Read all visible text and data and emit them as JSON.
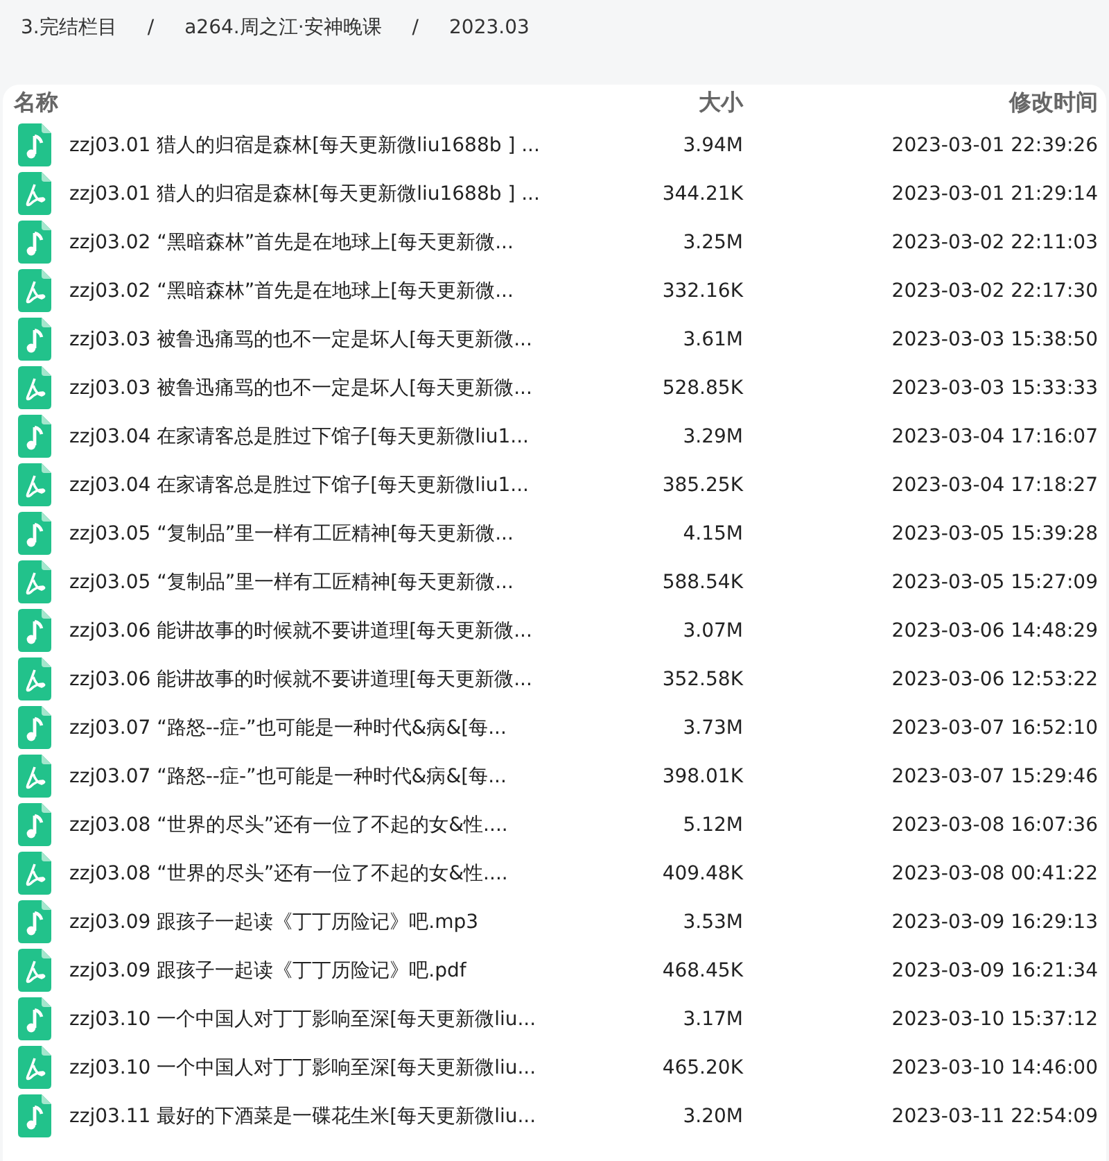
{
  "breadcrumb": [
    "3.完结栏目",
    "/",
    "a264.周之江·安神晚课",
    "/",
    "2023.03"
  ],
  "table": {
    "columns": [
      "名称",
      "大小",
      "修改时间"
    ],
    "rows": [
      {
        "kind": "audio",
        "name": "zzj03.01 猎人的归宿是森林[每天更新微liu1688b ] ...",
        "size": "3.94M",
        "time": "2023-03-01 22:39:26"
      },
      {
        "kind": "pdf",
        "name": "zzj03.01 猎人的归宿是森林[每天更新微liu1688b ] ...",
        "size": "344.21K",
        "time": "2023-03-01 21:29:14"
      },
      {
        "kind": "audio",
        "name": "zzj03.02 “黑暗森林”首先是在地球上[每天更新微...",
        "size": "3.25M",
        "time": "2023-03-02 22:11:03"
      },
      {
        "kind": "pdf",
        "name": "zzj03.02 “黑暗森林”首先是在地球上[每天更新微...",
        "size": "332.16K",
        "time": "2023-03-02 22:17:30"
      },
      {
        "kind": "audio",
        "name": "zzj03.03 被鲁迅痛骂的也不一定是坏人[每天更新微...",
        "size": "3.61M",
        "time": "2023-03-03 15:38:50"
      },
      {
        "kind": "pdf",
        "name": "zzj03.03 被鲁迅痛骂的也不一定是坏人[每天更新微...",
        "size": "528.85K",
        "time": "2023-03-03 15:33:33"
      },
      {
        "kind": "audio",
        "name": "zzj03.04 在家请客总是胜过下馆子[每天更新微liu1...",
        "size": "3.29M",
        "time": "2023-03-04 17:16:07"
      },
      {
        "kind": "pdf",
        "name": "zzj03.04 在家请客总是胜过下馆子[每天更新微liu1...",
        "size": "385.25K",
        "time": "2023-03-04 17:18:27"
      },
      {
        "kind": "audio",
        "name": "zzj03.05 “复制品”里一样有工匠精神[每天更新微...",
        "size": "4.15M",
        "time": "2023-03-05 15:39:28"
      },
      {
        "kind": "pdf",
        "name": "zzj03.05 “复制品”里一样有工匠精神[每天更新微...",
        "size": "588.54K",
        "time": "2023-03-05 15:27:09"
      },
      {
        "kind": "audio",
        "name": "zzj03.06 能讲故事的时候就不要讲道理[每天更新微...",
        "size": "3.07M",
        "time": "2023-03-06 14:48:29"
      },
      {
        "kind": "pdf",
        "name": "zzj03.06 能讲故事的时候就不要讲道理[每天更新微...",
        "size": "352.58K",
        "time": "2023-03-06 12:53:22"
      },
      {
        "kind": "audio",
        "name": "zzj03.07 “路怒--症-”也可能是一种时代&病&[每...",
        "size": "3.73M",
        "time": "2023-03-07 16:52:10"
      },
      {
        "kind": "pdf",
        "name": "zzj03.07 “路怒--症-”也可能是一种时代&病&[每...",
        "size": "398.01K",
        "time": "2023-03-07 15:29:46"
      },
      {
        "kind": "audio",
        "name": "zzj03.08 “世界的尽头”还有一位了不起的女&性....",
        "size": "5.12M",
        "time": "2023-03-08 16:07:36"
      },
      {
        "kind": "pdf",
        "name": "zzj03.08 “世界的尽头”还有一位了不起的女&性....",
        "size": "409.48K",
        "time": "2023-03-08 00:41:22"
      },
      {
        "kind": "audio",
        "name": "zzj03.09 跟孩子一起读《丁丁历险记》吧.mp3",
        "size": "3.53M",
        "time": "2023-03-09 16:29:13"
      },
      {
        "kind": "pdf",
        "name": "zzj03.09 跟孩子一起读《丁丁历险记》吧.pdf",
        "size": "468.45K",
        "time": "2023-03-09 16:21:34"
      },
      {
        "kind": "audio",
        "name": "zzj03.10 一个中国人对丁丁影响至深[每天更新微liu...",
        "size": "3.17M",
        "time": "2023-03-10 15:37:12"
      },
      {
        "kind": "pdf",
        "name": "zzj03.10 一个中国人对丁丁影响至深[每天更新微liu...",
        "size": "465.20K",
        "time": "2023-03-10 14:46:00"
      },
      {
        "kind": "audio",
        "name": "zzj03.11 最好的下酒菜是一碟花生米[每天更新微liu...",
        "size": "3.20M",
        "time": "2023-03-11 22:54:09"
      }
    ]
  }
}
